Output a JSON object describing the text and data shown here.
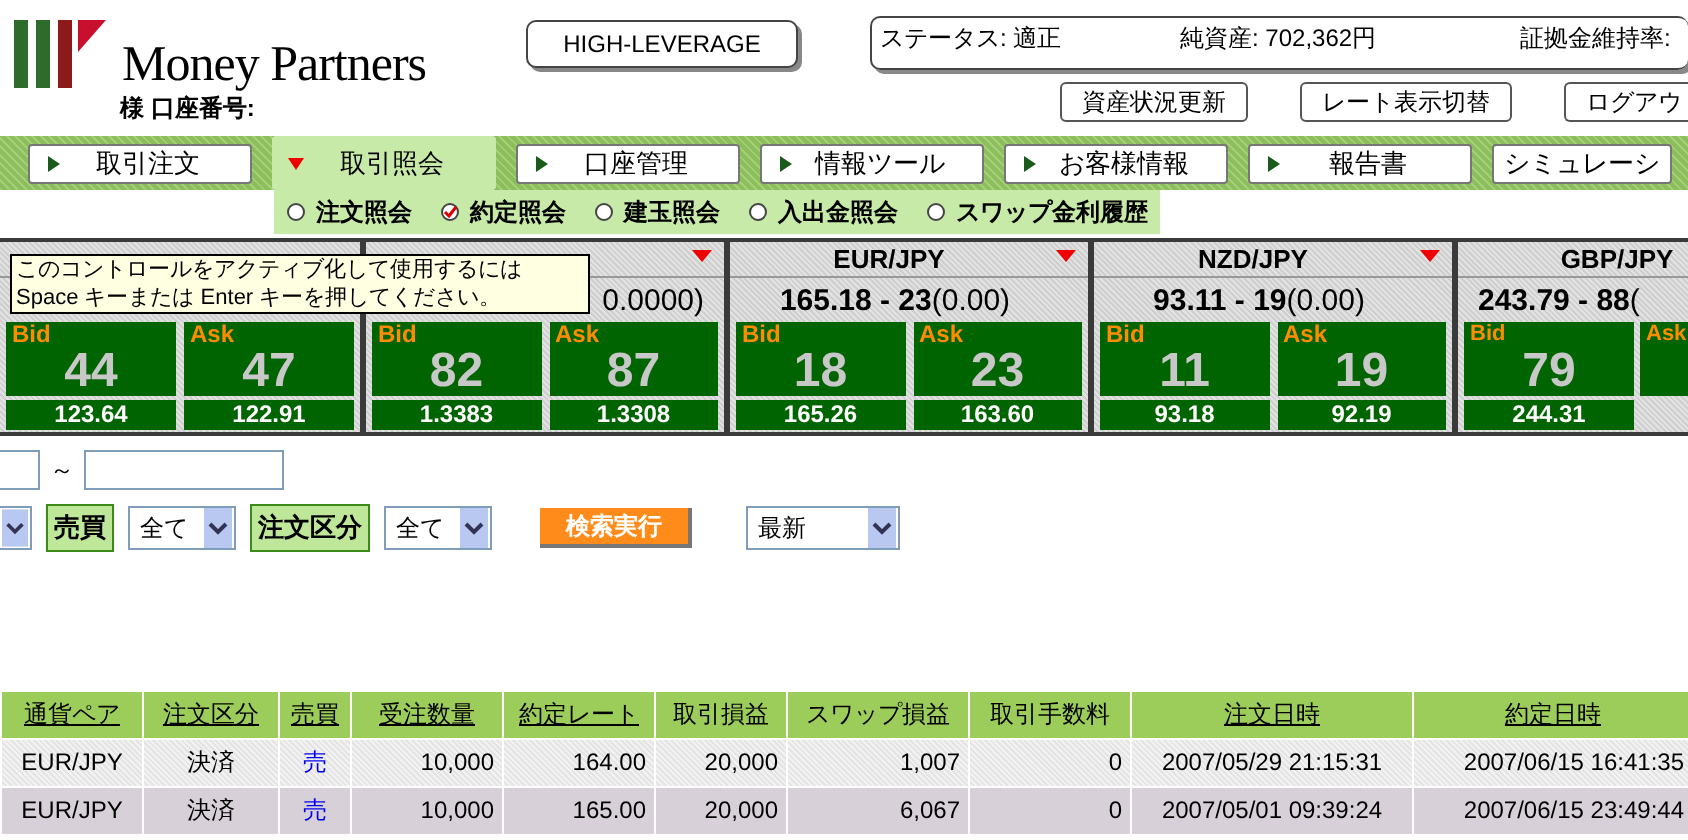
{
  "logo": {
    "text": "Money Partners"
  },
  "account": {
    "text": "様 口座番号:"
  },
  "mode_button": "HIGH-LEVERAGE",
  "status": [
    "ステータス: 適正",
    "純資産: 702,362円",
    "証拠金維持率:"
  ],
  "header_buttons": [
    "資産状況更新",
    "レート表示切替",
    "ログアウ"
  ],
  "tabs": [
    {
      "label": "取引注文",
      "selected": false
    },
    {
      "label": "取引照会",
      "selected": true
    },
    {
      "label": "口座管理",
      "selected": false
    },
    {
      "label": "情報ツール",
      "selected": false
    },
    {
      "label": "お客様情報",
      "selected": false
    },
    {
      "label": "報告書",
      "selected": false
    },
    {
      "label": "シミュレーシ",
      "selected": false
    }
  ],
  "subtabs": [
    {
      "label": "注文照会",
      "selected": false
    },
    {
      "label": "約定照会",
      "selected": true
    },
    {
      "label": "建玉照会",
      "selected": false
    },
    {
      "label": "入出金照会",
      "selected": false
    },
    {
      "label": "スワップ金利履歴",
      "selected": false
    }
  ],
  "tooltip": "このコントロールをアクティブ化して使用するには Space キーまたは Enter キーを押してください。",
  "rate_panels": [
    {
      "bid": {
        "label": "Bid",
        "pips": "44",
        "rate": "123.64"
      },
      "ask": {
        "label": "Ask",
        "pips": "47",
        "rate": "122.91"
      }
    },
    {
      "dropdown": true,
      "price_tail": "0.0000)",
      "bid": {
        "label": "Bid",
        "pips": "82",
        "rate": "1.3383"
      },
      "ask": {
        "label": "Ask",
        "pips": "87",
        "rate": "1.3308"
      }
    },
    {
      "dropdown": true,
      "pair": "EUR/JPY",
      "price": "165.18 - 23",
      "change": "(0.00)",
      "bid": {
        "label": "Bid",
        "pips": "18",
        "rate": "165.26"
      },
      "ask": {
        "label": "Ask",
        "pips": "23",
        "rate": "163.60"
      }
    },
    {
      "dropdown": true,
      "pair": "NZD/JPY",
      "price": "93.11 - 19",
      "change": "(0.00)",
      "bid": {
        "label": "Bid",
        "pips": "11",
        "rate": "93.18"
      },
      "ask": {
        "label": "Ask",
        "pips": "19",
        "rate": "92.19"
      }
    },
    {
      "pair": "GBP/JPY",
      "price": "243.79 - 88",
      "change": "(",
      "bid": {
        "label": "Bid",
        "pips": "79",
        "rate": "244.31"
      },
      "ask": {
        "label": "Ask"
      }
    }
  ],
  "date_range": {
    "separator": "～"
  },
  "filters": [
    {
      "kind": "select"
    },
    {
      "kind": "label",
      "text": "売買"
    },
    {
      "kind": "select",
      "value": "全て"
    },
    {
      "kind": "label",
      "text": "注文区分"
    },
    {
      "kind": "select",
      "value": "全て"
    },
    {
      "kind": "button",
      "text": "検索実行"
    },
    {
      "kind": "select",
      "value": "最新"
    }
  ],
  "table": {
    "columns": [
      {
        "label": "通貨ペア",
        "sortable": true
      },
      {
        "label": "注文区分",
        "sortable": true
      },
      {
        "label": "売買",
        "sortable": true
      },
      {
        "label": "受注数量",
        "sortable": true
      },
      {
        "label": "約定レート",
        "sortable": true
      },
      {
        "label": "取引損益",
        "sortable": false
      },
      {
        "label": "スワップ損益",
        "sortable": false
      },
      {
        "label": "取引手数料",
        "sortable": false
      },
      {
        "label": "注文日時",
        "sortable": true
      },
      {
        "label": "約定日時",
        "sortable": true
      }
    ],
    "rows": [
      [
        "EUR/JPY",
        "決済",
        "売",
        "10,000",
        "164.00",
        "20,000",
        "1,007",
        "0",
        "2007/05/29 21:15:31",
        "2007/06/15 16:41:35"
      ],
      [
        "EUR/JPY",
        "決済",
        "売",
        "10,000",
        "165.00",
        "20,000",
        "6,067",
        "0",
        "2007/05/01 09:39:24",
        "2007/06/15 23:49:44"
      ]
    ]
  }
}
